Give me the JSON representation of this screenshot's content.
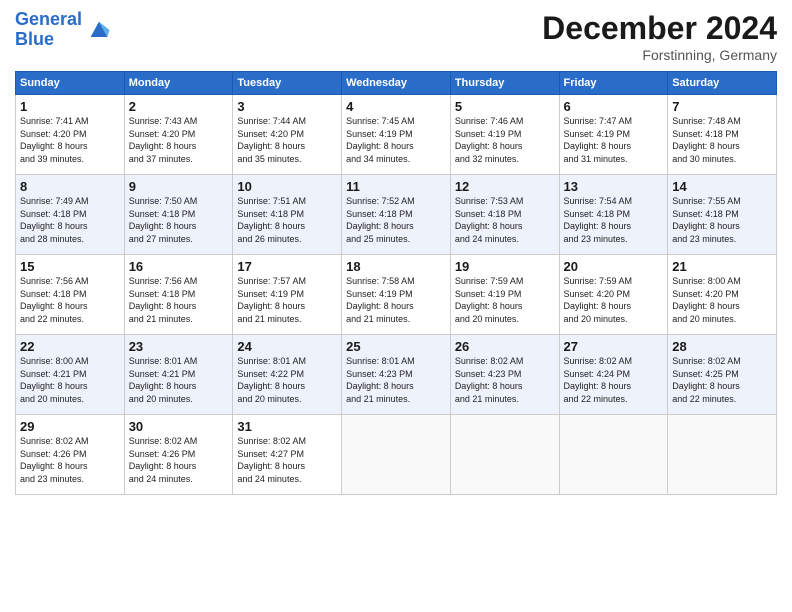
{
  "logo": {
    "line1": "General",
    "line2": "Blue"
  },
  "title": "December 2024",
  "location": "Forstinning, Germany",
  "days_header": [
    "Sunday",
    "Monday",
    "Tuesday",
    "Wednesday",
    "Thursday",
    "Friday",
    "Saturday"
  ],
  "weeks": [
    [
      {
        "day": "1",
        "detail": "Sunrise: 7:41 AM\nSunset: 4:20 PM\nDaylight: 8 hours\nand 39 minutes."
      },
      {
        "day": "2",
        "detail": "Sunrise: 7:43 AM\nSunset: 4:20 PM\nDaylight: 8 hours\nand 37 minutes."
      },
      {
        "day": "3",
        "detail": "Sunrise: 7:44 AM\nSunset: 4:20 PM\nDaylight: 8 hours\nand 35 minutes."
      },
      {
        "day": "4",
        "detail": "Sunrise: 7:45 AM\nSunset: 4:19 PM\nDaylight: 8 hours\nand 34 minutes."
      },
      {
        "day": "5",
        "detail": "Sunrise: 7:46 AM\nSunset: 4:19 PM\nDaylight: 8 hours\nand 32 minutes."
      },
      {
        "day": "6",
        "detail": "Sunrise: 7:47 AM\nSunset: 4:19 PM\nDaylight: 8 hours\nand 31 minutes."
      },
      {
        "day": "7",
        "detail": "Sunrise: 7:48 AM\nSunset: 4:18 PM\nDaylight: 8 hours\nand 30 minutes."
      }
    ],
    [
      {
        "day": "8",
        "detail": "Sunrise: 7:49 AM\nSunset: 4:18 PM\nDaylight: 8 hours\nand 28 minutes."
      },
      {
        "day": "9",
        "detail": "Sunrise: 7:50 AM\nSunset: 4:18 PM\nDaylight: 8 hours\nand 27 minutes."
      },
      {
        "day": "10",
        "detail": "Sunrise: 7:51 AM\nSunset: 4:18 PM\nDaylight: 8 hours\nand 26 minutes."
      },
      {
        "day": "11",
        "detail": "Sunrise: 7:52 AM\nSunset: 4:18 PM\nDaylight: 8 hours\nand 25 minutes."
      },
      {
        "day": "12",
        "detail": "Sunrise: 7:53 AM\nSunset: 4:18 PM\nDaylight: 8 hours\nand 24 minutes."
      },
      {
        "day": "13",
        "detail": "Sunrise: 7:54 AM\nSunset: 4:18 PM\nDaylight: 8 hours\nand 23 minutes."
      },
      {
        "day": "14",
        "detail": "Sunrise: 7:55 AM\nSunset: 4:18 PM\nDaylight: 8 hours\nand 23 minutes."
      }
    ],
    [
      {
        "day": "15",
        "detail": "Sunrise: 7:56 AM\nSunset: 4:18 PM\nDaylight: 8 hours\nand 22 minutes."
      },
      {
        "day": "16",
        "detail": "Sunrise: 7:56 AM\nSunset: 4:18 PM\nDaylight: 8 hours\nand 21 minutes."
      },
      {
        "day": "17",
        "detail": "Sunrise: 7:57 AM\nSunset: 4:19 PM\nDaylight: 8 hours\nand 21 minutes."
      },
      {
        "day": "18",
        "detail": "Sunrise: 7:58 AM\nSunset: 4:19 PM\nDaylight: 8 hours\nand 21 minutes."
      },
      {
        "day": "19",
        "detail": "Sunrise: 7:59 AM\nSunset: 4:19 PM\nDaylight: 8 hours\nand 20 minutes."
      },
      {
        "day": "20",
        "detail": "Sunrise: 7:59 AM\nSunset: 4:20 PM\nDaylight: 8 hours\nand 20 minutes."
      },
      {
        "day": "21",
        "detail": "Sunrise: 8:00 AM\nSunset: 4:20 PM\nDaylight: 8 hours\nand 20 minutes."
      }
    ],
    [
      {
        "day": "22",
        "detail": "Sunrise: 8:00 AM\nSunset: 4:21 PM\nDaylight: 8 hours\nand 20 minutes."
      },
      {
        "day": "23",
        "detail": "Sunrise: 8:01 AM\nSunset: 4:21 PM\nDaylight: 8 hours\nand 20 minutes."
      },
      {
        "day": "24",
        "detail": "Sunrise: 8:01 AM\nSunset: 4:22 PM\nDaylight: 8 hours\nand 20 minutes."
      },
      {
        "day": "25",
        "detail": "Sunrise: 8:01 AM\nSunset: 4:23 PM\nDaylight: 8 hours\nand 21 minutes."
      },
      {
        "day": "26",
        "detail": "Sunrise: 8:02 AM\nSunset: 4:23 PM\nDaylight: 8 hours\nand 21 minutes."
      },
      {
        "day": "27",
        "detail": "Sunrise: 8:02 AM\nSunset: 4:24 PM\nDaylight: 8 hours\nand 22 minutes."
      },
      {
        "day": "28",
        "detail": "Sunrise: 8:02 AM\nSunset: 4:25 PM\nDaylight: 8 hours\nand 22 minutes."
      }
    ],
    [
      {
        "day": "29",
        "detail": "Sunrise: 8:02 AM\nSunset: 4:26 PM\nDaylight: 8 hours\nand 23 minutes."
      },
      {
        "day": "30",
        "detail": "Sunrise: 8:02 AM\nSunset: 4:26 PM\nDaylight: 8 hours\nand 24 minutes."
      },
      {
        "day": "31",
        "detail": "Sunrise: 8:02 AM\nSunset: 4:27 PM\nDaylight: 8 hours\nand 24 minutes."
      },
      null,
      null,
      null,
      null
    ]
  ]
}
